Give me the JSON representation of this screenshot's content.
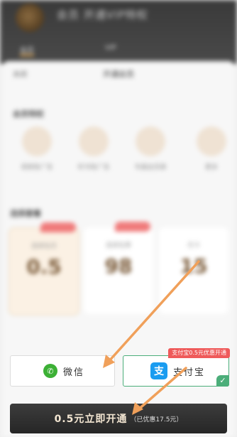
{
  "header": {
    "name": "会员 开通VIP特权",
    "tabs": [
      "会员",
      "VIP"
    ]
  },
  "sheet": {
    "title": "开通会员",
    "close_label": "关闭",
    "benefits_title": "会员特权",
    "benefits": [
      "视频免广告",
      "听书免广告",
      "专属会员章",
      "更多"
    ],
    "plans_title": "选择套餐",
    "plans": [
      {
        "name": "连续包月",
        "price": "0.5"
      },
      {
        "name": "连续包季",
        "price": "98"
      },
      {
        "name": "月卡",
        "price": "15"
      }
    ]
  },
  "payment": {
    "wechat_label": "微信",
    "alipay_label": "支付宝",
    "alipay_promo": "支付宝0.5元优惠开通",
    "check_glyph": "✓",
    "wechat_glyph": "✆",
    "alipay_glyph": "支"
  },
  "cta": {
    "main": "0.5元立即开通",
    "sub": "（已优惠17.5元）"
  },
  "colors": {
    "wechat": "#3cb035",
    "alipay": "#1a9cf0",
    "selected_border": "#4cae7a",
    "arrow": "#f0a05a"
  }
}
